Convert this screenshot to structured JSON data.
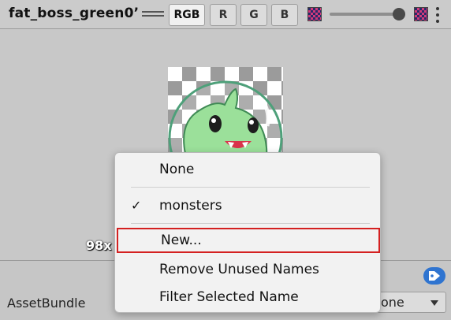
{
  "toolbar": {
    "asset_title": "fat_boss_green0’",
    "channels": [
      "RGB",
      "R",
      "G",
      "B"
    ],
    "active_channel": "RGB"
  },
  "preview": {
    "dimensions_label": "98x"
  },
  "context_menu": {
    "items": [
      {
        "label": "None",
        "checked": false
      },
      {
        "label": "monsters",
        "checked": true
      },
      {
        "label": "New...",
        "checked": false,
        "highlighted": true
      },
      {
        "label": "Remove Unused Names",
        "checked": false
      },
      {
        "label": "Filter Selected Name",
        "checked": false
      }
    ],
    "check_glyph": "✓",
    "highlight_color": "#d42020"
  },
  "bottom": {
    "asset_bundle_label": "AssetBundle",
    "variant_value": "one"
  },
  "colors": {
    "tag_icon": "#2f74d0",
    "slime_green": "#9be09a",
    "slime_outline": "#4ea07a"
  },
  "icons": [
    "drag-handle-icon",
    "checker-alpha-icon",
    "checker-color-icon",
    "kebab-menu-icon",
    "tag-icon",
    "checkmark-icon",
    "dropdown-arrow-icon"
  ]
}
